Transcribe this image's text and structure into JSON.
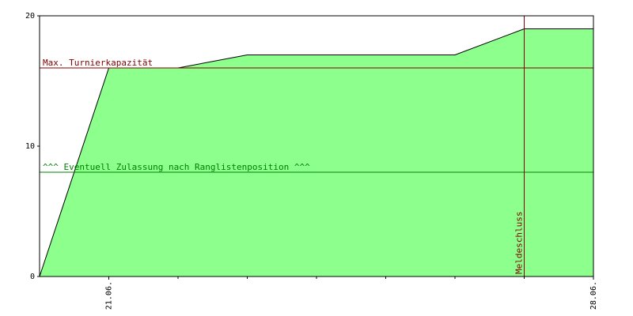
{
  "chart_data": {
    "type": "area",
    "title": "",
    "xlabel": "",
    "ylabel": "",
    "ylim": [
      0,
      20
    ],
    "yticks": [
      0,
      10,
      20
    ],
    "xlim": [
      0,
      8
    ],
    "xticks": [
      {
        "x": 1,
        "label": "21.06."
      },
      {
        "x": 8,
        "label": "28.06."
      }
    ],
    "minor_xticks": [
      2,
      3,
      4,
      5,
      6,
      7
    ],
    "series": [
      {
        "x": [
          0,
          1,
          2,
          3,
          4,
          5,
          6,
          7,
          8
        ],
        "values": [
          0,
          16,
          16,
          17,
          17,
          17,
          17,
          19,
          19
        ],
        "fill": "#8cff8c",
        "line": "#000000"
      }
    ],
    "reference_lines": [
      {
        "axis": "y",
        "value": 16,
        "label": "Max. Turnierkapazität",
        "color": "#800000"
      },
      {
        "axis": "y",
        "value": 8,
        "label": "^^^ Eventuell Zulassung nach Ranglistenposition ^^^",
        "color": "#008000"
      },
      {
        "axis": "x",
        "value": 7,
        "label": "Meldeschluss",
        "color": "#800000"
      }
    ],
    "grid": false,
    "legend": "none"
  }
}
